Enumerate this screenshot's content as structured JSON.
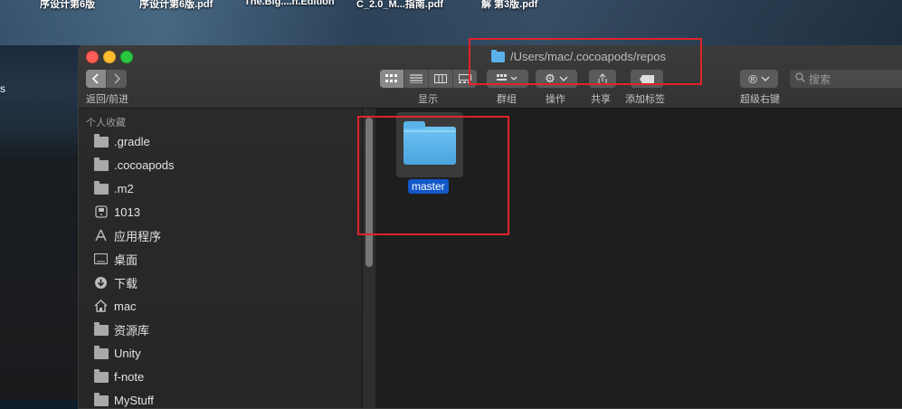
{
  "desktop": {
    "files": [
      "序设计第6版",
      "序设计第6版.pdf",
      "The.Big....n.Edition",
      "C_2.0_M...指南.pdf",
      "解 第3版.pdf"
    ],
    "edge_text": "s"
  },
  "window": {
    "title_path": "/Users/mac/.cocoapods/repos"
  },
  "toolbar": {
    "nav_label": "返回/前进",
    "view_label": "显示",
    "group_label": "群组",
    "action_label": "操作",
    "share_label": "共享",
    "tag_label": "添加标签",
    "super_label": "超级右键",
    "search_placeholder": "搜索"
  },
  "sidebar": {
    "header": "个人收藏",
    "items": [
      {
        "label": ".gradle",
        "icon": "folder-icon"
      },
      {
        "label": ".cocoapods",
        "icon": "folder-icon"
      },
      {
        "label": ".m2",
        "icon": "folder-icon"
      },
      {
        "label": "1013",
        "icon": "disk-icon"
      },
      {
        "label": "应用程序",
        "icon": "applications-icon"
      },
      {
        "label": "桌面",
        "icon": "desktop-icon"
      },
      {
        "label": "下载",
        "icon": "download-icon"
      },
      {
        "label": "mac",
        "icon": "home-icon"
      },
      {
        "label": "资源库",
        "icon": "folder-icon"
      },
      {
        "label": "Unity",
        "icon": "folder-icon"
      },
      {
        "label": "f-note",
        "icon": "folder-icon"
      },
      {
        "label": "MyStuff",
        "icon": "folder-icon"
      }
    ]
  },
  "content": {
    "files": [
      {
        "name": "master",
        "type": "folder"
      }
    ]
  },
  "colors": {
    "highlight": "#e0232a",
    "selection": "#1358c8",
    "folder": "#5bb0e8"
  }
}
